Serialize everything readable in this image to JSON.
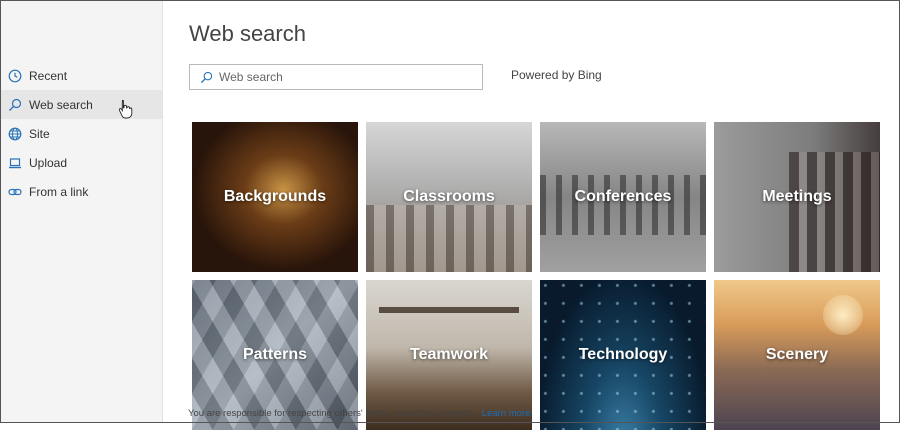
{
  "sidebar": {
    "items": [
      {
        "label": "Recent",
        "icon": "clock-icon"
      },
      {
        "label": "Web search",
        "icon": "search-icon",
        "active": true
      },
      {
        "label": "Site",
        "icon": "globe-icon"
      },
      {
        "label": "Upload",
        "icon": "laptop-icon"
      },
      {
        "label": "From a link",
        "icon": "link-icon"
      }
    ]
  },
  "main": {
    "title": "Web search",
    "search": {
      "placeholder": "Web search",
      "value": ""
    },
    "powered_by": "Powered by Bing",
    "tiles": [
      {
        "label": "Backgrounds"
      },
      {
        "label": "Classrooms"
      },
      {
        "label": "Conferences"
      },
      {
        "label": "Meetings"
      },
      {
        "label": "Patterns"
      },
      {
        "label": "Teamwork"
      },
      {
        "label": "Technology"
      },
      {
        "label": "Scenery"
      }
    ],
    "footer": {
      "text": "You are responsible for respecting others' rights, including copyright.",
      "link": "Learn more."
    }
  },
  "colors": {
    "accent": "#1a6fb5",
    "sidebar_bg": "#f4f4f4",
    "active_item_bg": "#e6e6e6"
  }
}
